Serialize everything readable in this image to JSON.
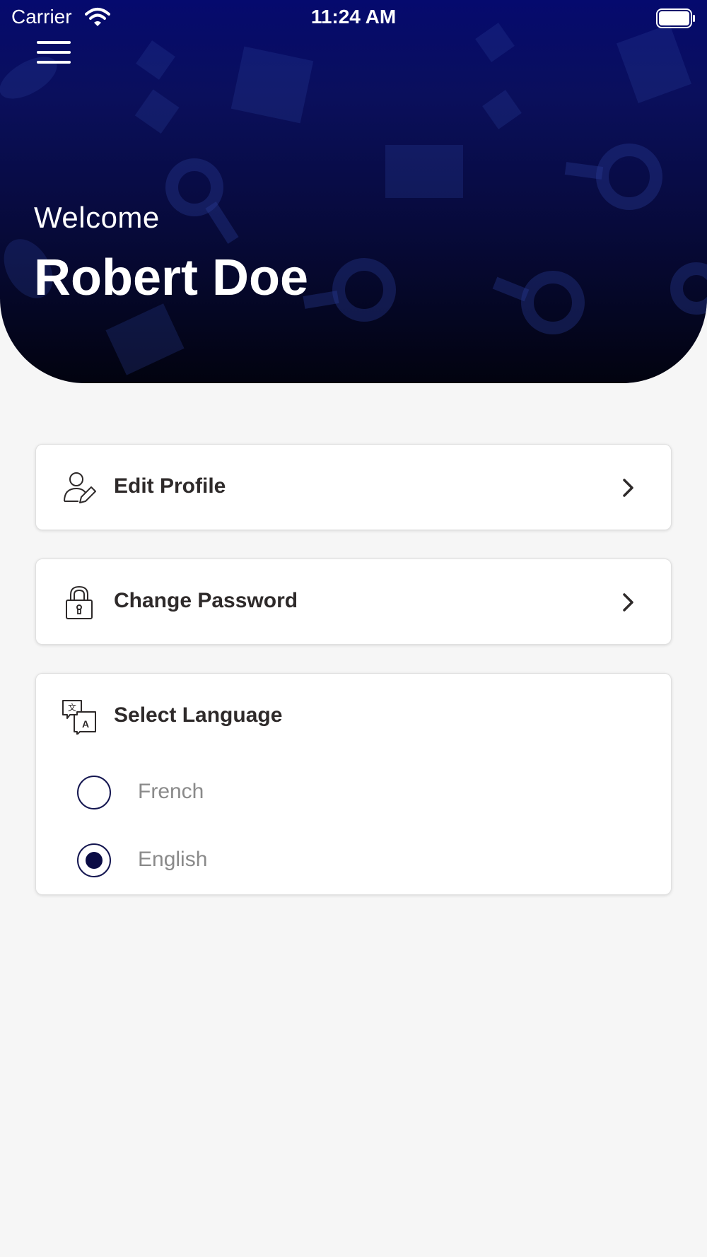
{
  "status_bar": {
    "carrier": "Carrier",
    "time": "11:24 AM"
  },
  "header": {
    "welcome": "Welcome",
    "user_name": "Robert Doe",
    "gradient_top": "#050a6e",
    "gradient_bottom": "#02030f"
  },
  "menu": {
    "edit_profile": "Edit Profile",
    "change_password": "Change Password"
  },
  "language": {
    "title": "Select Language",
    "options": [
      {
        "label": "French",
        "selected": false
      },
      {
        "label": "English",
        "selected": true
      }
    ]
  },
  "colors": {
    "accent": "#0b0c45",
    "background": "#f6f6f6",
    "text_dark": "#2e2a2a",
    "text_muted": "#8a8a8a"
  },
  "icons": {
    "menu": "hamburger-icon",
    "edit_profile": "user-edit-icon",
    "change_password": "padlock-icon",
    "language": "translate-icon",
    "chevron": "chevron-right-icon"
  }
}
